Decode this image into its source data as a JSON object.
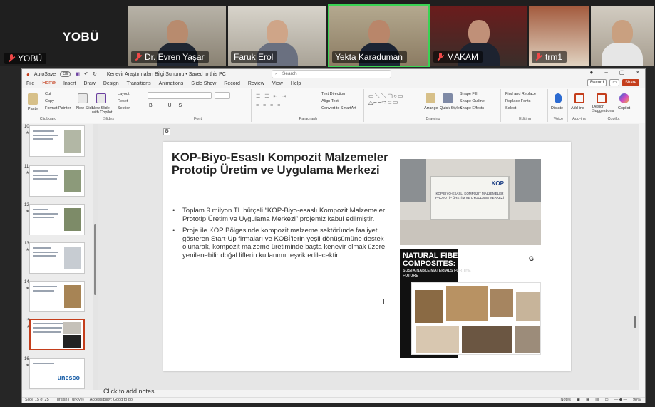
{
  "meeting": {
    "host_name": "YOBÜ",
    "host_big": "YOBÜ",
    "participants": [
      {
        "name": "Dr. Evren Yaşar",
        "muted": true
      },
      {
        "name": "Faruk Erol",
        "muted": false
      },
      {
        "name": "Yekta Karaduman",
        "muted": false,
        "active": true
      },
      {
        "name": "MAKAM",
        "muted": true
      },
      {
        "name": "trm1",
        "muted": true
      },
      {
        "name": "",
        "muted": false
      }
    ]
  },
  "ppt": {
    "autosave": "AutoSave",
    "autosave_state": "Off",
    "doc_title": "Kenevir Araştırmaları Bilgi Sunumu • Saved to this PC",
    "search_placeholder": "Search",
    "menu": [
      "File",
      "Home",
      "Insert",
      "Draw",
      "Design",
      "Transitions",
      "Animations",
      "Slide Show",
      "Record",
      "Review",
      "View",
      "Help"
    ],
    "record_label": "Record",
    "share_label": "Share",
    "ribbon_groups": {
      "clipboard": "Clipboard",
      "slides": "Slides",
      "font": "Font",
      "paragraph": "Paragraph",
      "drawing": "Drawing",
      "editing": "Editing",
      "voice": "Voice",
      "addins": "Add-ins",
      "copilot": "Copilot"
    },
    "ribbon_labels": {
      "paste": "Paste",
      "cut": "Cut",
      "copy": "Copy",
      "format_painter": "Format Painter",
      "new_slide": "New Slide",
      "new_slide_copilot": "New Slide with Copilot",
      "layout": "Layout",
      "reset": "Reset",
      "section": "Section",
      "text_direction": "Text Direction",
      "align_text": "Align Text",
      "convert_smartart": "Convert to SmartArt",
      "arrange": "Arrange",
      "quick_styles": "Quick Styles",
      "shape_fill": "Shape Fill",
      "shape_outline": "Shape Outline",
      "shape_effects": "Shape Effects",
      "find_replace": "Find and Replace",
      "replace_fonts": "Replace Fonts",
      "select": "Select",
      "dictate": "Dictate",
      "addins": "Add-ins",
      "design": "Design Suggestions",
      "copilot": "Copilot"
    },
    "thumbnails": [
      {
        "num": "10"
      },
      {
        "num": "11"
      },
      {
        "num": "12"
      },
      {
        "num": "13"
      },
      {
        "num": "14"
      },
      {
        "num": "15",
        "selected": true
      },
      {
        "num": "16"
      },
      {
        "num": "17"
      }
    ],
    "slide": {
      "title": "KOP-Biyo-Esaslı Kompozit Malzemeler Prototip Üretim ve Uygulama Merkezi",
      "bullets": [
        "Toplam 9 milyon TL bütçeli “KOP-Biyo-esaslı Kompozit Malzemeler Prototip Üretim ve Uygulama Merkezi” projemiz kabul edilmiştir.",
        "Proje ile KOP Bölgesinde kompozit malzeme sektöründe faaliyet gösteren Start-Up firmaları ve KOBİ’lerin yeşil dönüşümüne destek olunarak, kompozit malzeme üretiminde başta kenevir olmak üzere yenilenebilir doğal liflerin kullanımı teşvik edilecektir."
      ],
      "photo_logo": "KOP",
      "photo_sign": "KOP BİYO-ESASLI KOMPOZİT MALZEMELER PROTOTİP ÜRETİM VE UYGULAMA MERKEZİ",
      "nf_title": "NATURAL FIBER COMPOSITES:",
      "nf_subtitle": "SUSTAINABLE MATERIALS FOR THE FUTURE",
      "nf_icon": "G",
      "thumb16_logo": "unesco"
    },
    "notes_placeholder": "Click to add notes",
    "status": {
      "slide_info": "Slide 15 of 25",
      "language": "Turkish (Türkiye)",
      "accessibility": "Accessibility: Good to go",
      "notes": "Notes",
      "zoom": "98%"
    }
  }
}
